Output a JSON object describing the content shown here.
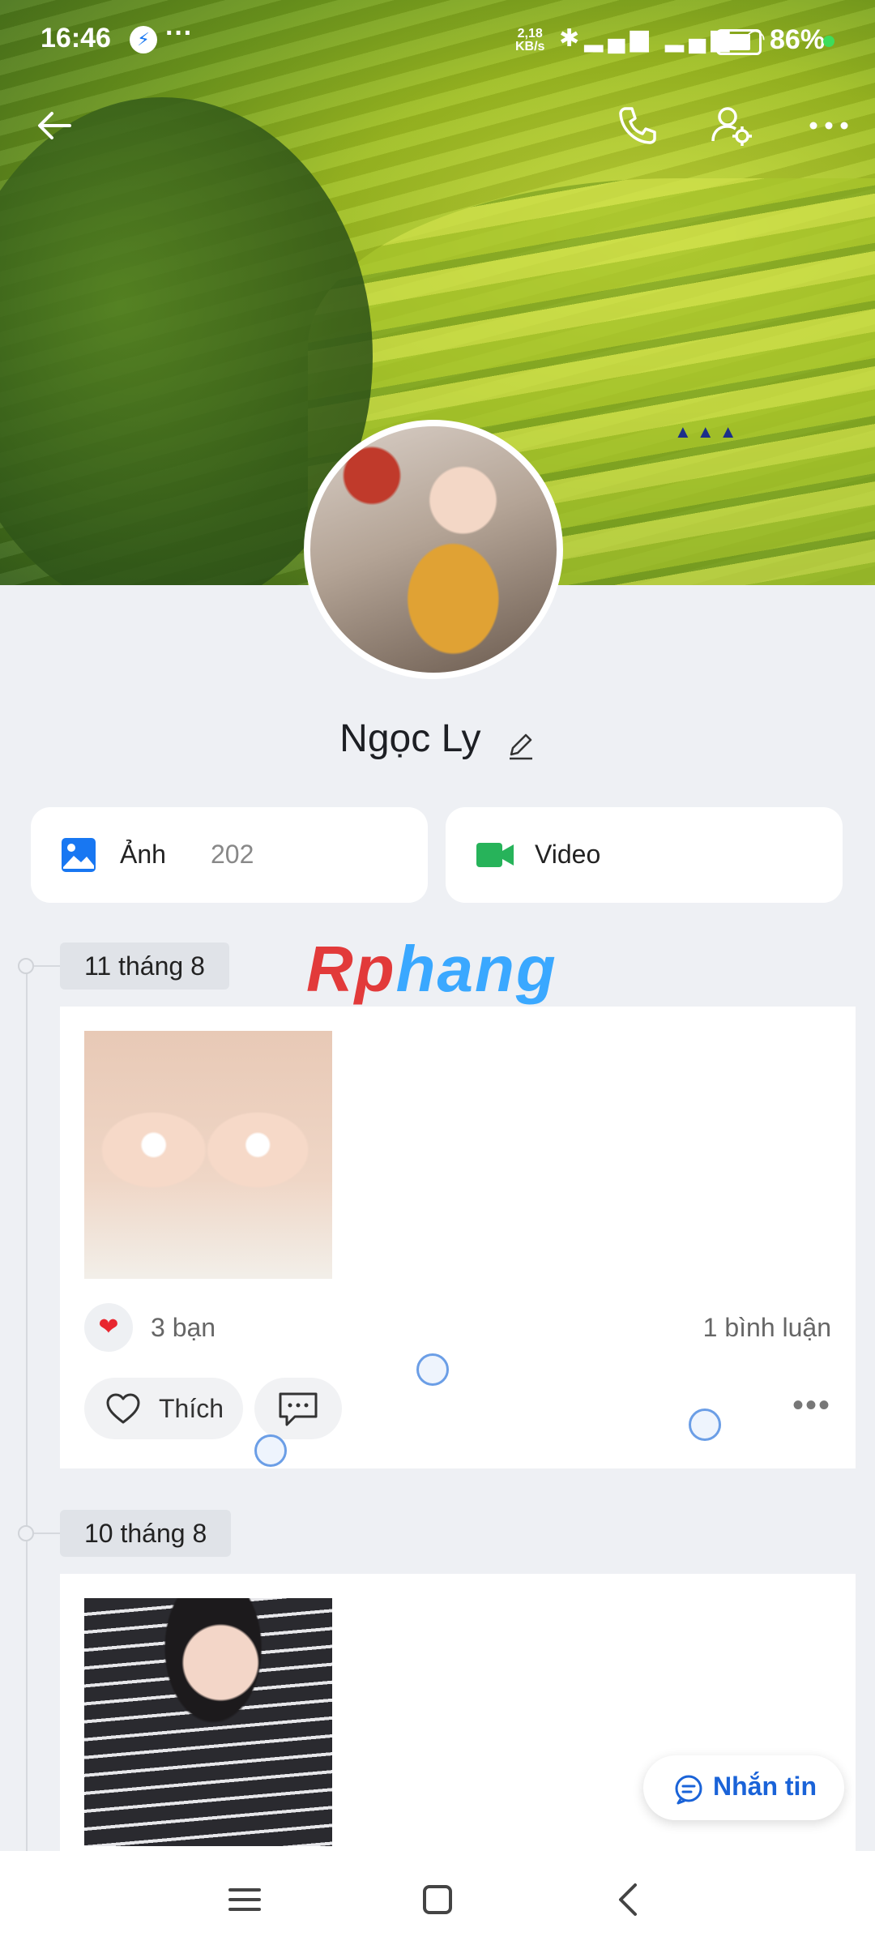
{
  "status_bar": {
    "time": "16:46",
    "net_speed_value": "2,18",
    "net_speed_unit": "KB/s",
    "battery": "86%"
  },
  "profile": {
    "name": "Ngọc Ly"
  },
  "tabs": {
    "photos_label": "Ảnh",
    "photos_count": "202",
    "video_label": "Video"
  },
  "watermark": {
    "part_a": "Rp",
    "part_b": "hang"
  },
  "posts": [
    {
      "date": "11 tháng 8",
      "reactions": "3 bạn",
      "comments": "1 bình luận",
      "like_label": "Thích"
    },
    {
      "date": "10 tháng 8"
    }
  ],
  "fab": {
    "label": "Nhắn tin"
  },
  "icons": [
    "back-icon",
    "phone-icon",
    "user-settings-icon",
    "more-icon",
    "pencil-icon",
    "photo-icon",
    "video-icon",
    "heart-icon",
    "comment-icon",
    "chat-icon",
    "menu-icon",
    "home-icon",
    "nav-back-icon"
  ],
  "colors": {
    "accent_blue": "#1a63d8",
    "video_green": "#27b35a",
    "photo_blue": "#1877f2",
    "heart_red": "#e8262f",
    "background": "#eef0f4"
  }
}
